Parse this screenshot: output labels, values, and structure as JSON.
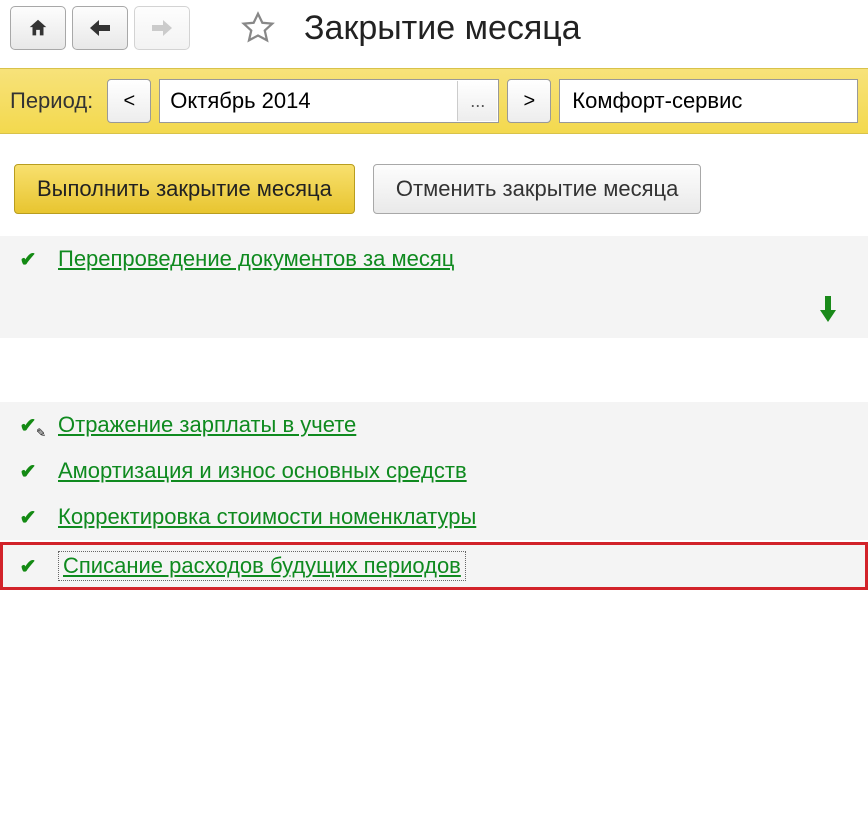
{
  "header": {
    "title": "Закрытие месяца"
  },
  "period": {
    "label": "Период:",
    "value": "Октябрь 2014",
    "org": "Комфорт-сервис"
  },
  "actions": {
    "execute": "Выполнить закрытие месяца",
    "cancel": "Отменить закрытие месяца"
  },
  "operations": {
    "reprocess": "Перепроведение документов за месяц",
    "salary": "Отражение зарплаты в учете",
    "amortization": "Амортизация и износ основных средств",
    "cost_correction": "Корректировка стоимости номенклатуры",
    "future_expenses": "Списание расходов будущих периодов"
  }
}
